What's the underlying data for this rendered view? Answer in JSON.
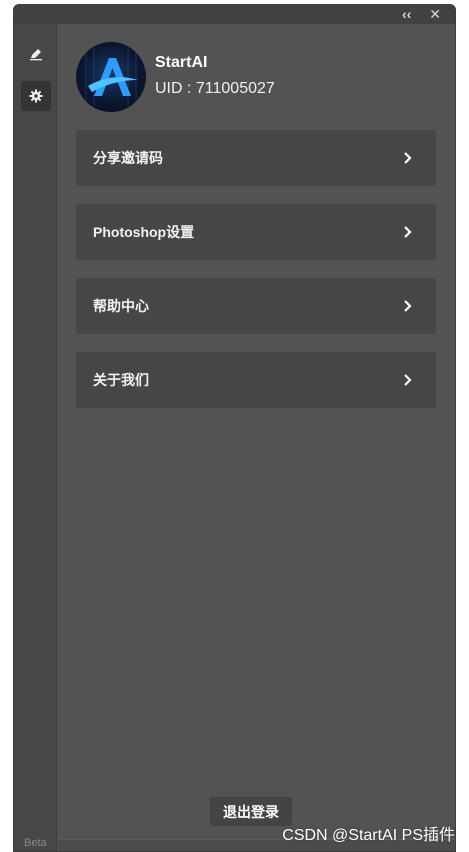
{
  "titlebar": {
    "collapse_label": "‹‹",
    "close_label": "✕"
  },
  "rail": {
    "items": [
      {
        "icon": "pen-icon"
      },
      {
        "icon": "gear-icon",
        "active": true
      }
    ],
    "beta_label": "Beta"
  },
  "profile": {
    "username": "StartAI",
    "uid": "UID : 711005027",
    "avatar_letter": "A"
  },
  "menu": [
    {
      "label": "分享邀请码"
    },
    {
      "label": "Photoshop设置"
    },
    {
      "label": "帮助中心"
    },
    {
      "label": "关于我们"
    }
  ],
  "logout_label": "退出登录",
  "watermark": "CSDN @StartAI PS插件",
  "colors": {
    "panel": "#535353",
    "rail": "#474747",
    "menu_item": "#464646",
    "accent": "#3aa0ff"
  }
}
